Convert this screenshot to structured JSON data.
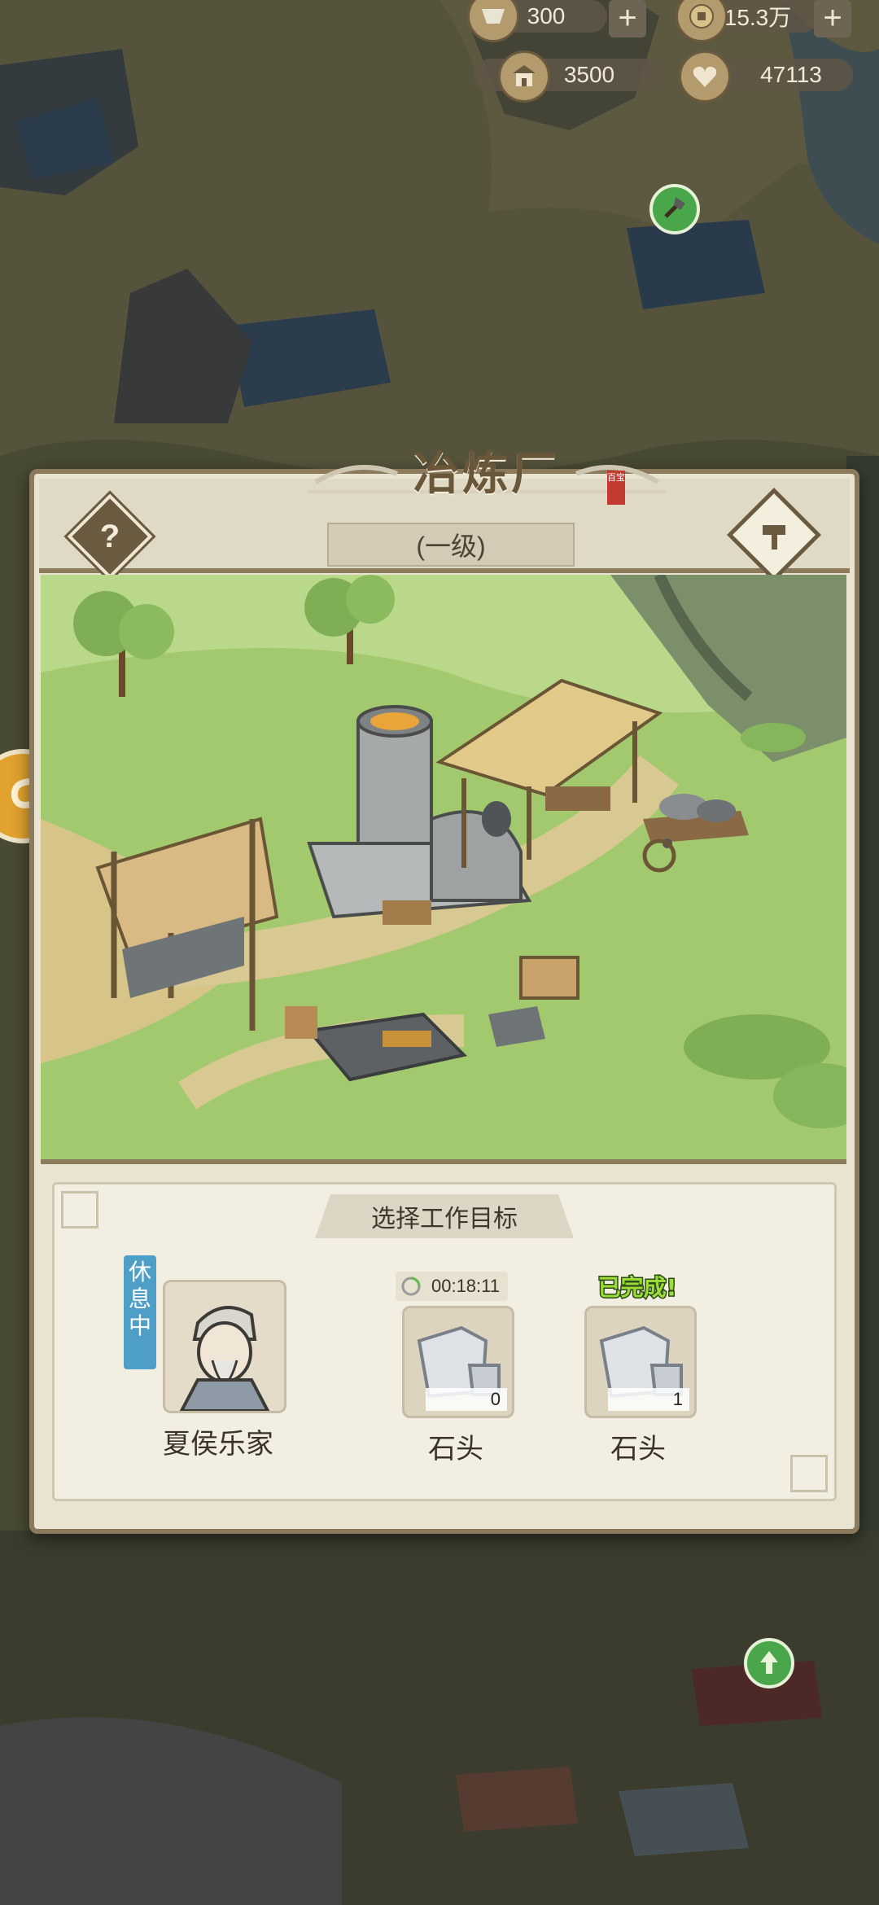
{
  "resources": {
    "top_left_value": "300",
    "top_right_value": "15.3万",
    "building_value": "3500",
    "heart_value": "47113"
  },
  "dialog": {
    "title": "冶炼厂",
    "seal_text": "百宝",
    "level": "(一级)",
    "help_symbol": "?"
  },
  "panel": {
    "title": "选择工作目标",
    "worker": {
      "status": "休息中",
      "name": "夏侯乐家"
    },
    "slots": [
      {
        "timer": "00:18:11",
        "count": "0",
        "label": "石头"
      },
      {
        "status": "已完成!",
        "count": "1",
        "label": "石头"
      }
    ]
  },
  "icons": [
    "cup-icon",
    "coin-icon",
    "building-icon",
    "heart-icon",
    "hammer-icon",
    "axe-marker-icon",
    "upgrade-marker-icon"
  ],
  "colors": {
    "frame": "#8c7a5c",
    "panel_bg": "#f2eee2",
    "rest_tag": "#4e9fc7",
    "done_green": "#9bdc3a"
  }
}
